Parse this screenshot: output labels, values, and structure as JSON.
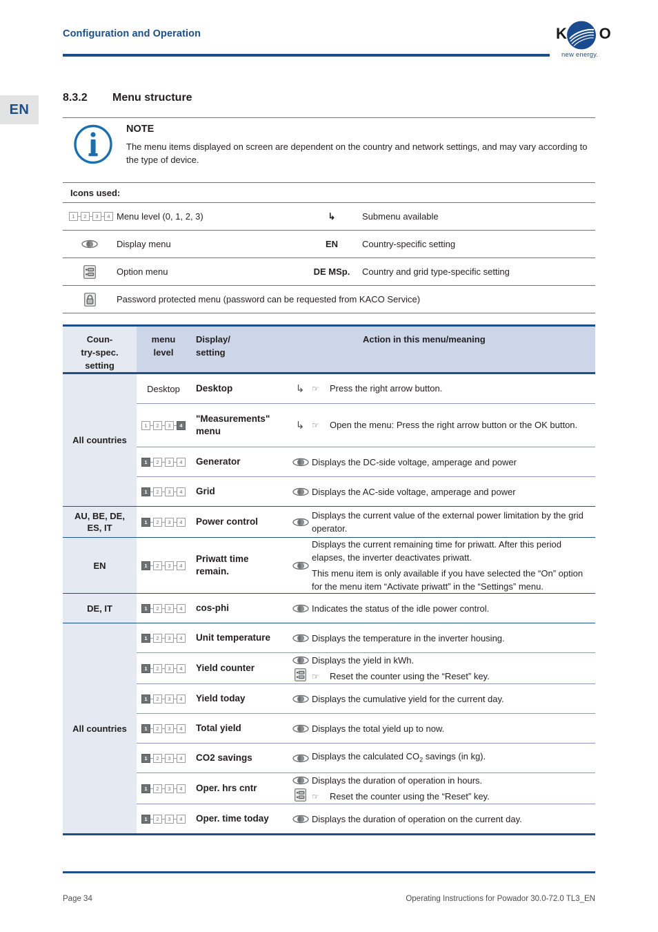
{
  "header": {
    "title": "Configuration and Operation",
    "logo_word": "KACO",
    "logo_tagline": "new energy."
  },
  "lang_tab": "EN",
  "section": {
    "number": "8.3.2",
    "title": "Menu structure"
  },
  "note": {
    "title": "NOTE",
    "body": "The menu items displayed on screen are dependent on the country and network settings, and may vary according to the type of device."
  },
  "legend": {
    "title": "Icons used:",
    "rows": [
      {
        "left_icon": "menu-level-icon",
        "left_text": "Menu level (0, 1, 2, 3)",
        "right_icon": "submenu-arrow-icon",
        "right_glyph": "↳",
        "right_text": "Submenu available"
      },
      {
        "left_icon": "display-menu-icon",
        "left_text": "Display menu",
        "right_icon": "country-code-label",
        "right_glyph": "EN",
        "right_text": "Country-specific setting"
      },
      {
        "left_icon": "option-menu-icon",
        "left_text": "Option menu",
        "right_icon": "country-grid-label",
        "right_glyph": "DE MSp.",
        "right_text": "Country and grid type-specific setting"
      }
    ],
    "password_row": {
      "icon": "padlock-icon",
      "text": "Password protected menu (password can be requested from KACO Service)"
    }
  },
  "table": {
    "headers": {
      "country": "Coun-\ntry-spec.\nsetting",
      "country_l1": "Coun-",
      "country_l2": "try-spec.",
      "country_l3": "setting",
      "level_l1": "menu",
      "level_l2": "level",
      "display_l1": "Display/",
      "display_l2": "setting",
      "action": "Action in this menu/meaning"
    },
    "bands": [
      {
        "country": "All countries",
        "rows": [
          {
            "level_text": "Desktop",
            "level_icon": null,
            "display": "Desktop",
            "sub_arrow": "↳",
            "icons": [],
            "actions": [
              {
                "hand": "☞",
                "text": "Press the right arrow button."
              }
            ]
          },
          {
            "level_text": null,
            "level_icon": {
              "type": "menu-level",
              "active": 4,
              "style": "light"
            },
            "display": "\"Measurements\"\nmenu",
            "display_l1": "\"Measurements\"",
            "display_l2": "menu",
            "sub_arrow": "↳",
            "icons": [],
            "actions": [
              {
                "hand": "☞",
                "text": "Open the menu: Press the right arrow button or the OK button."
              }
            ]
          },
          {
            "level_text": null,
            "level_icon": {
              "type": "menu-level",
              "active": 1,
              "style": "dark"
            },
            "display": "Generator",
            "sub_arrow": null,
            "icons": [
              "display-menu-icon"
            ],
            "actions": [
              {
                "hand": null,
                "text": "Displays the DC-side voltage, amperage and power"
              }
            ]
          },
          {
            "level_text": null,
            "level_icon": {
              "type": "menu-level",
              "active": 1,
              "style": "dark"
            },
            "display": "Grid",
            "sub_arrow": null,
            "icons": [
              "display-menu-icon"
            ],
            "actions": [
              {
                "hand": null,
                "text": "Displays the AC-side voltage, amperage and power"
              }
            ]
          }
        ]
      },
      {
        "country": "AU, BE,  DE,\nES, IT",
        "country_l1": "AU, BE,  DE,",
        "country_l2": "ES, IT",
        "rows": [
          {
            "level_text": null,
            "level_icon": {
              "type": "menu-level",
              "active": 1,
              "style": "dark"
            },
            "display": "Power control",
            "sub_arrow": null,
            "icons": [
              "display-menu-icon"
            ],
            "actions": [
              {
                "hand": null,
                "text": "Displays the current value of the external power limitation by the grid operator."
              }
            ]
          }
        ]
      },
      {
        "country": "EN",
        "rows": [
          {
            "level_text": null,
            "level_icon": {
              "type": "menu-level",
              "active": 1,
              "style": "dark"
            },
            "display": "Priwatt time\nremain.",
            "display_l1": "Priwatt time",
            "display_l2": "remain.",
            "sub_arrow": null,
            "icons": [
              "display-menu-icon"
            ],
            "actions": [
              {
                "hand": null,
                "text": "Displays the current remaining time for priwatt. After this period elapses, the inverter deactivates priwatt."
              },
              {
                "hand": null,
                "text": "This menu item is only available if you have selected the “On” option for the menu item “Activate priwatt” in the “Settings” menu."
              }
            ]
          }
        ]
      },
      {
        "country": "DE, IT",
        "rows": [
          {
            "level_text": null,
            "level_icon": {
              "type": "menu-level",
              "active": 1,
              "style": "dark"
            },
            "display": "cos-phi",
            "sub_arrow": null,
            "icons": [
              "display-menu-icon"
            ],
            "actions": [
              {
                "hand": null,
                "text": "Indicates the status of the idle power control."
              }
            ]
          }
        ]
      },
      {
        "country": "All countries",
        "rows": [
          {
            "level_text": null,
            "level_icon": {
              "type": "menu-level",
              "active": 1,
              "style": "dark"
            },
            "display": "Unit temperature",
            "sub_arrow": null,
            "icons": [
              "display-menu-icon"
            ],
            "actions": [
              {
                "hand": null,
                "text": "Displays the temperature in the inverter housing."
              }
            ]
          },
          {
            "level_text": null,
            "level_icon": {
              "type": "menu-level",
              "active": 1,
              "style": "dark"
            },
            "display": "Yield counter",
            "sub_arrow": null,
            "icons": [
              "display-menu-icon",
              "option-menu-icon"
            ],
            "actions": [
              {
                "hand": null,
                "text": "Displays the yield in kWh."
              },
              {
                "hand": "☞",
                "text": "Reset the counter using the “Reset” key."
              }
            ]
          },
          {
            "level_text": null,
            "level_icon": {
              "type": "menu-level",
              "active": 1,
              "style": "dark"
            },
            "display": "Yield today",
            "sub_arrow": null,
            "icons": [
              "display-menu-icon"
            ],
            "actions": [
              {
                "hand": null,
                "text": "Displays the cumulative yield for the current day."
              }
            ]
          },
          {
            "level_text": null,
            "level_icon": {
              "type": "menu-level",
              "active": 1,
              "style": "dark"
            },
            "display": "Total yield",
            "sub_arrow": null,
            "icons": [
              "display-menu-icon"
            ],
            "actions": [
              {
                "hand": null,
                "text": "Displays the total yield up to now."
              }
            ]
          },
          {
            "level_text": null,
            "level_icon": {
              "type": "menu-level",
              "active": 1,
              "style": "dark"
            },
            "display": "CO2 savings",
            "sub_arrow": null,
            "icons": [
              "display-menu-icon"
            ],
            "actions": [
              {
                "hand": null,
                "text": "Displays the calculated CO2 savings (in kg).",
                "rich": "co2"
              }
            ]
          },
          {
            "level_text": null,
            "level_icon": {
              "type": "menu-level",
              "active": 1,
              "style": "dark"
            },
            "display": "Oper. hrs cntr",
            "sub_arrow": null,
            "icons": [
              "display-menu-icon",
              "option-menu-icon"
            ],
            "actions": [
              {
                "hand": null,
                "text": "Displays the duration of operation in hours."
              },
              {
                "hand": "☞",
                "text": "Reset the counter using the “Reset” key."
              }
            ]
          },
          {
            "level_text": null,
            "level_icon": {
              "type": "menu-level",
              "active": 1,
              "style": "dark"
            },
            "display": "Oper. time today",
            "sub_arrow": null,
            "icons": [
              "display-menu-icon"
            ],
            "actions": [
              {
                "hand": null,
                "text": "Displays the duration of operation on the current day."
              }
            ]
          }
        ]
      }
    ]
  },
  "footer": {
    "left": "Page 34",
    "right": "Operating Instructions for Powador 30.0-72.0 TL3_EN"
  },
  "colors": {
    "brand_blue": "#1b4f8a",
    "header_fill": "#ccd6e8",
    "country_fill": "#e4e9f2",
    "icon_gray": "#6f7173"
  }
}
